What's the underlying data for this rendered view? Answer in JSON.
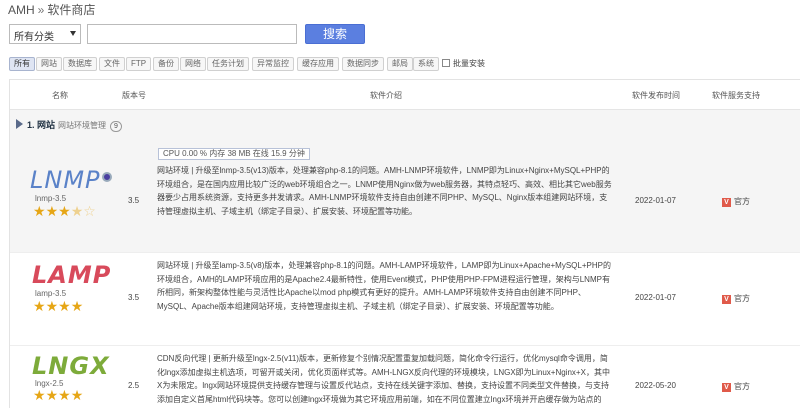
{
  "breadcrumb": {
    "root": "AMH",
    "separator": "»",
    "current": "软件商店"
  },
  "filter": {
    "category_select": "所有分类",
    "search_value": "",
    "search_button": "搜索"
  },
  "categories": [
    "所有",
    "网站",
    "数据库",
    "文件",
    "FTP",
    "备份",
    "网络",
    "任务计划",
    "异常监控",
    "缓存应用",
    "数据同步",
    "邮局",
    "系统"
  ],
  "batch_install": "批量安装",
  "table": {
    "headers": {
      "name": "名称",
      "version": "版本号",
      "intro": "软件介绍",
      "release_time": "软件发布时间",
      "support": "软件服务支持"
    },
    "group": {
      "title": "1. 网站",
      "subtitle": "网站环境管理",
      "count": "9"
    },
    "rows": [
      {
        "logo": "LNMP",
        "name_version": "lnmp-3.5",
        "stars": 3.5,
        "version": "3.5",
        "stats": "CPU 0.00 %   内存 38 MB   在线 15.9 分钟",
        "desc": "网站环境 | 升级至lnmp-3.5(v13)版本，处理兼容php-8.1的问题。AMH-LNMP环境软件，LNMP即为Linux+Nginx+MySQL+PHP的环境组合，是在国内应用比较广泛的web环境组合之一。LNMP使用Nginx做为web服务器，其特点轻巧、高效、相比其它web服务器要少占用系统资源，支持更多并发请求。AMH-LNMP环境软件支持自由创建不同PHP、MySQL、Nginx版本组建网站环境，支持管理虚拟主机、子域主机（绑定子目录）、扩展安装、环境配置等功能。",
        "date": "2022-01-07",
        "support_badge": "V",
        "support": "官方"
      },
      {
        "logo": "LAMP",
        "name_version": "lamp-3.5",
        "stars": 4,
        "version": "3.5",
        "desc": "网站环境 | 升级至lamp-3.5(v8)版本，处理兼容php-8.1的问题。AMH-LAMP环境软件，LAMP即为Linux+Apache+MySQL+PHP的环境组合，AMH的LAMP环境应用的是Apache2.4最新特性，使用Event模式，PHP使用PHP-FPM进程运行管理，架构与LNMP有所相同，新架构整体性能与灵活性比Apache以mod php模式有更好的提升。AMH-LAMP环境软件支持自由创建不同PHP、MySQL、Apache版本组建网站环境，支持管理虚拟主机、子域主机（绑定子目录）、扩展安装、环境配置等功能。",
        "date": "2022-01-07",
        "support_badge": "V",
        "support": "官方"
      },
      {
        "logo": "LNGX",
        "name_version": "lngx-2.5",
        "stars": 4,
        "version": "2.5",
        "desc": "CDN反向代理 | 更新升级至lngx-2.5(v11)版本，更新修复个别情况配置重复加载问题，简化命令行运行，优化mysql命令调用，简化lngx添加虚拟主机选项，可留开或关闭，优化页面样式等。AMH-LNGX反向代理的环境模块，LNGX即为Linux+Nginx+X，其中X为未限定。lngx网站环境提供支持缓存管理与设置反代站点，支持在线关键字添加、替换，支持设置不同类型文件替换，与支持添加自定义首尾html代码块等。您可以创建lngx环境做为其它环境应用前端，如在不同位置建立lngx环境并开启缓存做为站点的CDN加速镜像等。",
        "date": "2022-05-20",
        "support_badge": "V",
        "support": "官方"
      }
    ]
  }
}
